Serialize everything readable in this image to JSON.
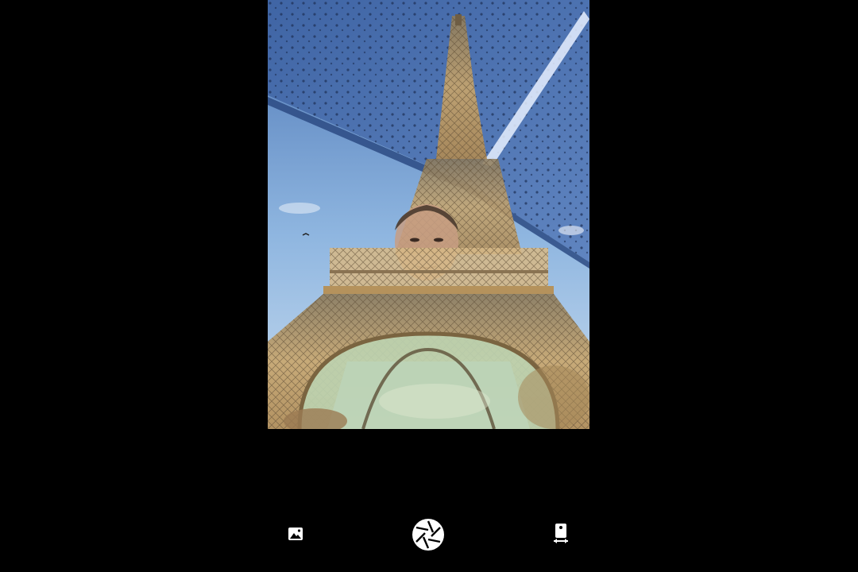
{
  "app": {
    "name": "camera",
    "background": "#000000"
  },
  "viewfinder": {
    "content": "camera-preview-image",
    "colors": {
      "sky_top": "#4a74b4",
      "sky_bottom": "#b9d4ee",
      "tower": "#c7a46e",
      "ceiling": "#3f62a0"
    }
  },
  "controls": {
    "gallery": {
      "icon": "gallery-icon",
      "color": "#ffffff"
    },
    "shutter": {
      "icon": "shutter-icon",
      "color": "#ffffff"
    },
    "switch_camera": {
      "icon": "switch-camera-icon",
      "color": "#ffffff"
    }
  }
}
